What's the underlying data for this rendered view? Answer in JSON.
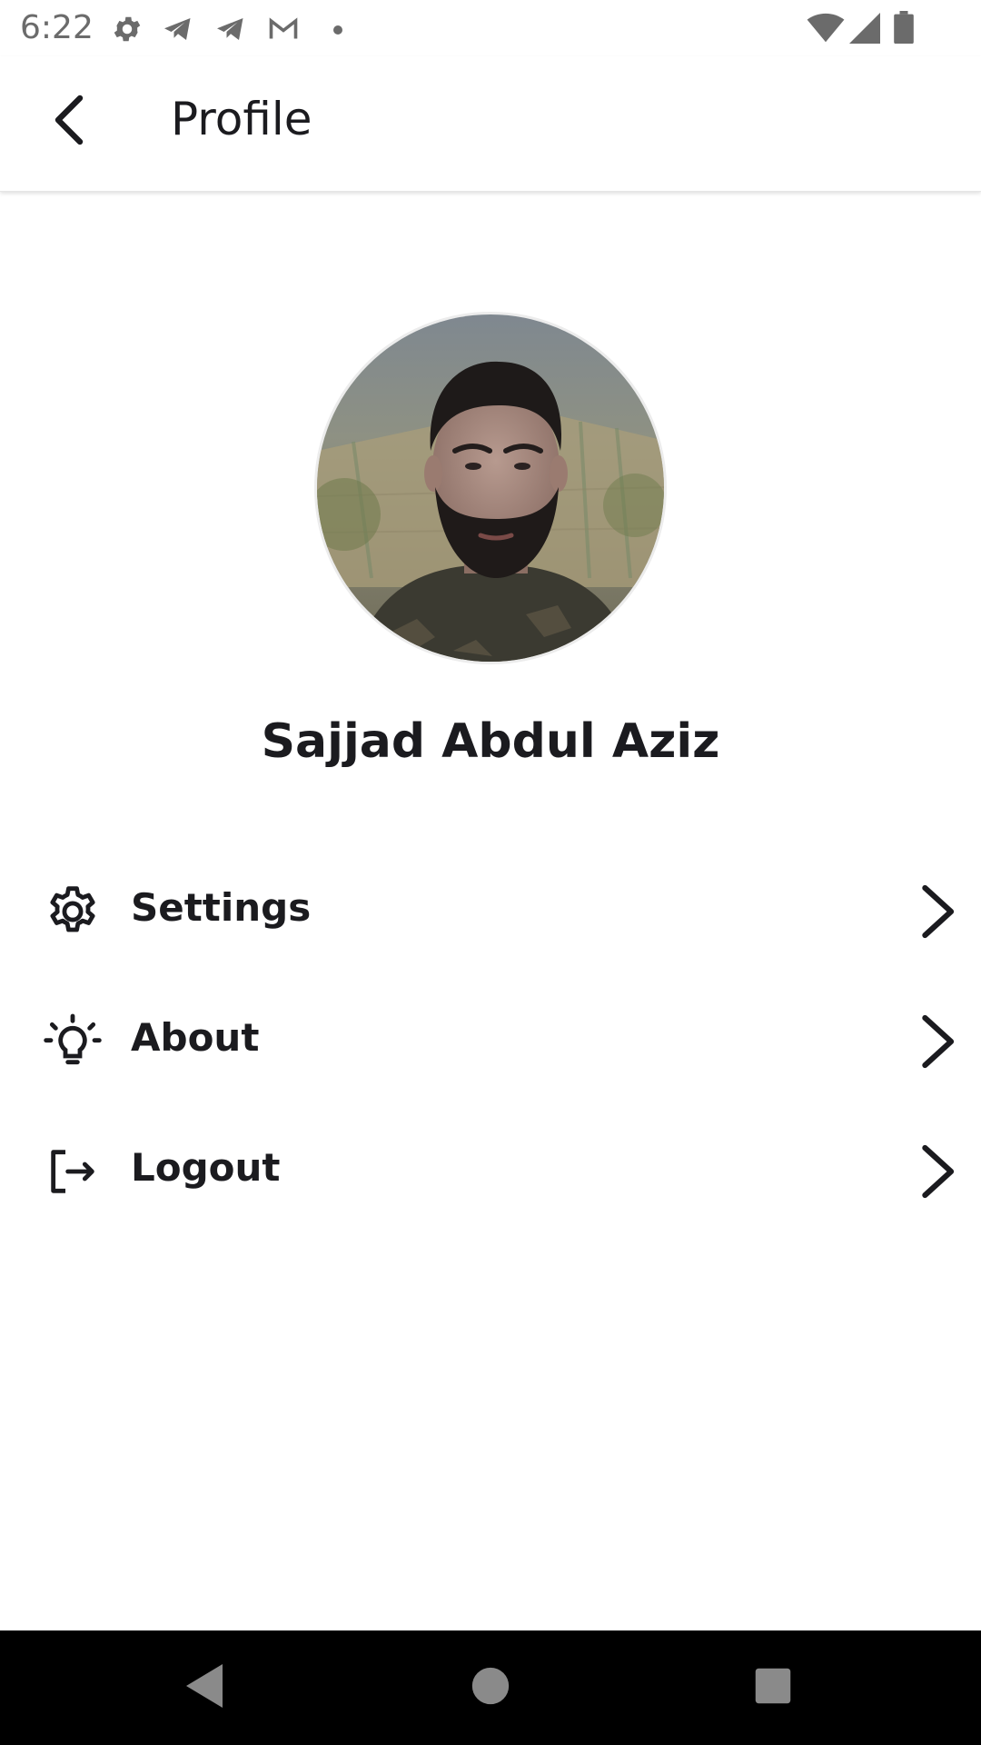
{
  "status_bar": {
    "time": "6:22",
    "left_icons": [
      "settings-icon",
      "telegram-icon",
      "telegram-icon",
      "gmail-icon",
      "dot-icon"
    ],
    "right_icons": [
      "wifi-icon",
      "signal-icon",
      "battery-icon"
    ]
  },
  "app_bar": {
    "back_icon": "arrow-back-icon",
    "title": "Profile"
  },
  "profile": {
    "name": "Sajjad Abdul Aziz"
  },
  "menu": {
    "items": [
      {
        "icon": "gear-icon",
        "label": "Settings"
      },
      {
        "icon": "lightbulb-icon",
        "label": "About"
      },
      {
        "icon": "logout-icon",
        "label": "Logout"
      }
    ]
  },
  "nav_bar": {
    "buttons": [
      "back-triangle-icon",
      "home-circle-icon",
      "recents-square-icon"
    ]
  },
  "colors": {
    "text": "#1b1b1f",
    "status_text": "#6b6b6b",
    "background": "#ffffff",
    "nav_bar": "#000000",
    "nav_icons": "#8a8a8a"
  }
}
